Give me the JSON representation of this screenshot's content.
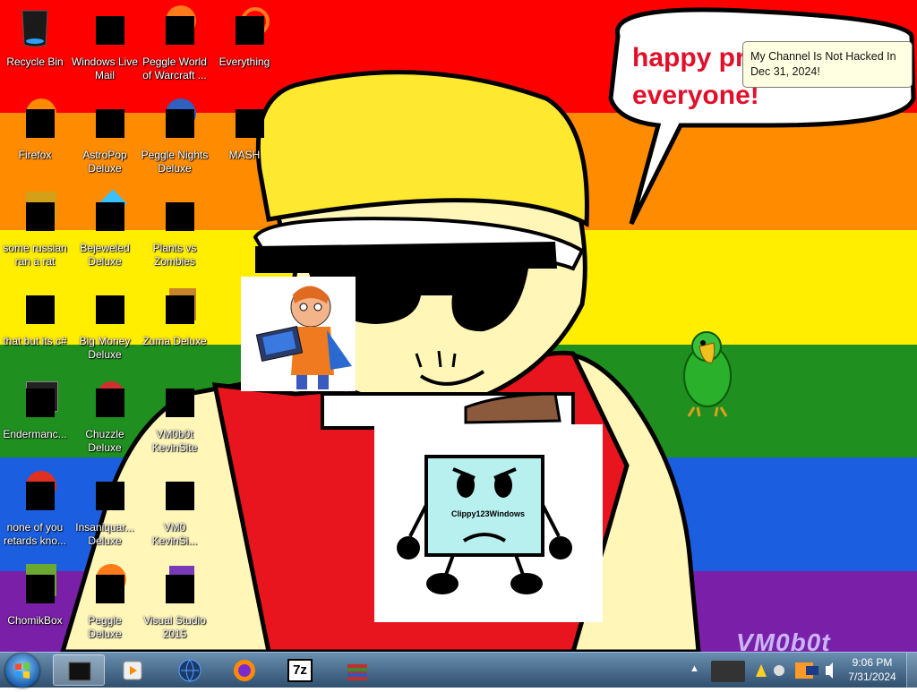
{
  "wallpaper": {
    "speech_bubble": {
      "line1": "happy pri",
      "line2": "everyone!"
    },
    "watermark": "VM0b0t",
    "stripe_colors": [
      "#ff0000",
      "#ff8c00",
      "#ffee00",
      "#1f8f1f",
      "#1b5fe0",
      "#7a1fa8"
    ]
  },
  "tooltip": {
    "text": "My Channel Is Not Hacked In Dec 31, 2024!"
  },
  "desktop_icons": [
    {
      "label": "Recycle Bin",
      "icon": "recycle-bin-icon",
      "covered": false
    },
    {
      "label": "Windows Live Mail",
      "icon": "mail-icon",
      "covered": true
    },
    {
      "label": "Peggle World of Warcraft ...",
      "icon": "peggle-icon",
      "covered": true
    },
    {
      "label": "Everything",
      "icon": "search-icon",
      "covered": true
    },
    {
      "label": "Firefox",
      "icon": "firefox-icon",
      "covered": true
    },
    {
      "label": "AstroPop Deluxe",
      "icon": "game-icon",
      "covered": true
    },
    {
      "label": "Peggle Nights Deluxe",
      "icon": "peggle-icon",
      "covered": true
    },
    {
      "label": "MASH",
      "icon": "app-icon",
      "covered": true
    },
    {
      "label": "some russian ran a rat",
      "icon": "app-icon",
      "covered": true
    },
    {
      "label": "Bejeweled Deluxe",
      "icon": "gem-icon",
      "covered": true
    },
    {
      "label": "Plants vs Zombies",
      "icon": "plant-icon",
      "covered": true
    },
    {
      "label": "that but its c#",
      "icon": "shortcut-icon",
      "covered": true
    },
    {
      "label": "Big Money Deluxe",
      "icon": "money-bag-icon",
      "covered": true
    },
    {
      "label": "Zuma Deluxe",
      "icon": "game-icon",
      "covered": true
    },
    {
      "label": "Endermanc...",
      "icon": "terminal-icon",
      "covered": true
    },
    {
      "label": "Chuzzle Deluxe",
      "icon": "game-icon",
      "covered": true
    },
    {
      "label": "VM0b0t KevinSite",
      "icon": "app-icon",
      "covered": true
    },
    {
      "label": "none of you retards kno...",
      "icon": "chrome-icon",
      "covered": true
    },
    {
      "label": "Insaniquar... Deluxe",
      "icon": "fish-icon",
      "covered": true
    },
    {
      "label": "VM0 KevinSi...",
      "icon": "document-icon",
      "covered": true
    },
    {
      "label": "ChomikBox",
      "icon": "hamster-icon",
      "covered": true
    },
    {
      "label": "Peggle Deluxe",
      "icon": "peggle-icon",
      "covered": true
    },
    {
      "label": "Visual Studio 2015",
      "icon": "visual-studio-icon",
      "covered": true
    }
  ],
  "stickers": {
    "clippy": {
      "label": "Clippy123Windows"
    }
  },
  "taskbar": {
    "start": "windows-orb-icon",
    "pinned": [
      {
        "name": "computer",
        "icon": "computer-icon",
        "active": true
      },
      {
        "name": "media-player",
        "icon": "media-player-icon",
        "active": false
      },
      {
        "name": "globe",
        "icon": "globe-icon",
        "active": false
      },
      {
        "name": "firefox",
        "icon": "firefox-icon",
        "active": false
      },
      {
        "name": "7zip",
        "icon": "seven-zip-icon",
        "text": "7z",
        "active": false
      },
      {
        "name": "winrar",
        "icon": "archive-icon",
        "active": false
      }
    ],
    "clock": {
      "time": "9:06 PM",
      "date": "7/31/2024"
    }
  }
}
